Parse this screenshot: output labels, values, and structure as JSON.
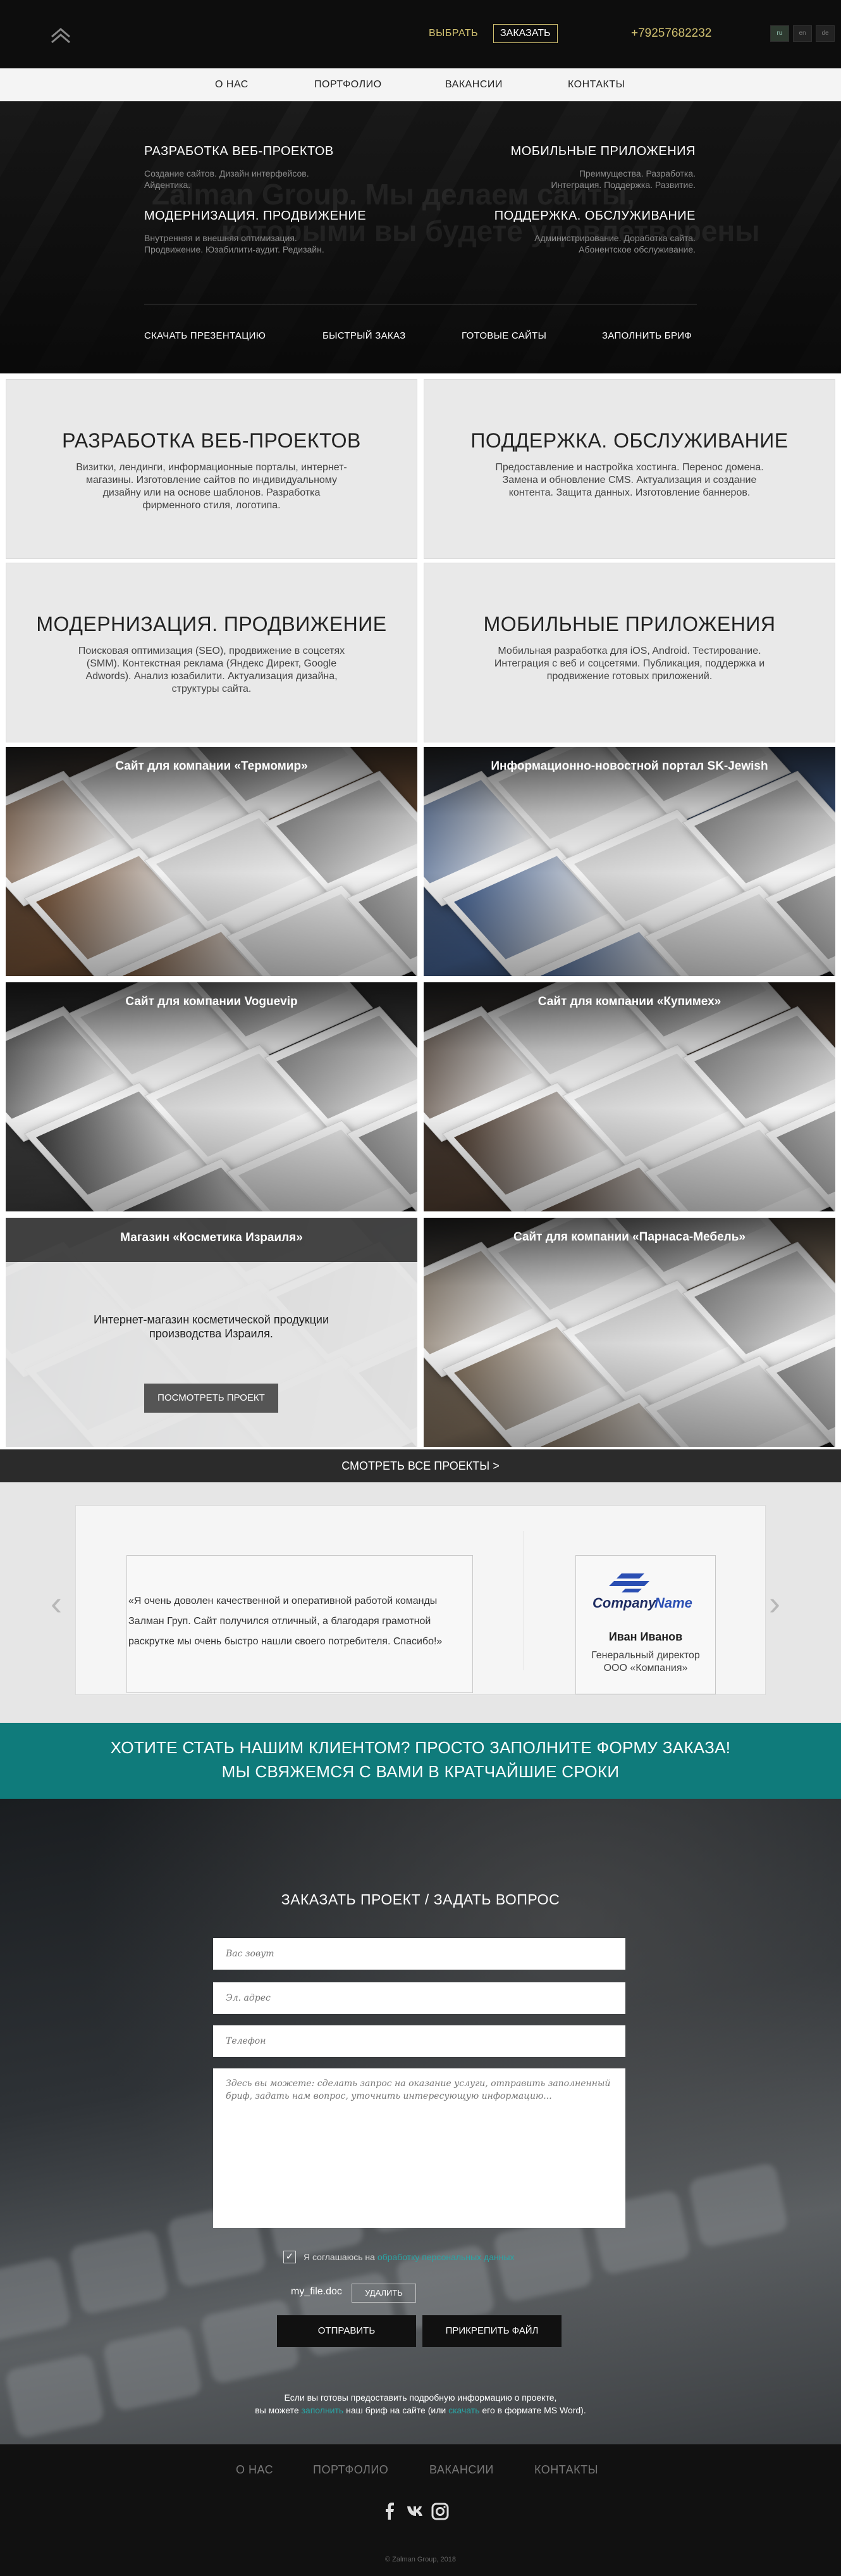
{
  "topbar": {
    "choose": "ВЫБРАТЬ",
    "order": "ЗАКАЗАТЬ",
    "phone": "+79257682232",
    "langs": [
      "ru",
      "en",
      "de"
    ]
  },
  "nav": {
    "items": [
      "О НАС",
      "ПОРТФОЛИО",
      "ВАКАНСИИ",
      "КОНТАКТЫ"
    ]
  },
  "hero": {
    "watermark_line1": "Zalman Group. Мы делаем сайты,",
    "watermark_line2": "которыми вы будете удовлетворены",
    "blocks": [
      {
        "title": "РАЗРАБОТКА ВЕБ-ПРОЕКТОВ",
        "line1": "Создание сайтов. Дизайн интерфейсов.",
        "line2": "Айдентика."
      },
      {
        "title": "МОБИЛЬНЫЕ ПРИЛОЖЕНИЯ",
        "line1": "Преимущества. Разработка.",
        "line2": "Интеграция. Поддержка. Развитие."
      },
      {
        "title": "МОДЕРНИЗАЦИЯ. ПРОДВИЖЕНИЕ",
        "line1": "Внутренняя и внешняя оптимизация.",
        "line2": "Продвижение. Юзабилити-аудит. Редизайн."
      },
      {
        "title": "ПОДДЕРЖКА. ОБСЛУЖИВАНИЕ",
        "line1": "Администрирование. Доработка сайта.",
        "line2": "Абонентское обслуживание."
      }
    ],
    "links": [
      "СКАЧАТЬ ПРЕЗЕНТАЦИЮ",
      "БЫСТРЫЙ ЗАКАЗ",
      "ГОТОВЫЕ САЙТЫ",
      "ЗАПОЛНИТЬ БРИФ"
    ]
  },
  "services": [
    {
      "title": "РАЗРАБОТКА ВЕБ-ПРОЕКТОВ",
      "text": "Визитки, лендинги, информационные порталы, интернет-магазины. Изготовление сайтов по индивидуальному дизайну или на основе шаблонов. Разработка фирменного стиля, логотипа."
    },
    {
      "title": "ПОДДЕРЖКА. ОБСЛУЖИВАНИЕ",
      "text": "Предоставление и настройка хостинга. Перенос домена. Замена и обновление CMS. Актуализация и создание контента. Защита данных. Изготовление баннеров."
    },
    {
      "title": "МОДЕРНИЗАЦИЯ. ПРОДВИЖЕНИЕ",
      "text": "Поисковая оптимизация (SEO), продвижение в соцсетях (SMM). Контекстная реклама (Яндекс Директ, Google Adwords). Анализ юзабилити. Актуализация дизайна, структуры сайта."
    },
    {
      "title": "МОБИЛЬНЫЕ ПРИЛОЖЕНИЯ",
      "text": "Мобильная разработка для iOS, Android. Тестирование. Интеграция с веб и соцсетями. Публикация, поддержка и продвижение готовых приложений."
    }
  ],
  "portfolio": {
    "items": [
      {
        "title": "Сайт для компании «Термомир»",
        "tint": "#6b4b32"
      },
      {
        "title": "Информационно-новостной портал SK-Jewish",
        "tint": "#3f5a86"
      },
      {
        "title": "Сайт для компании Voguevip",
        "tint": "#3a3a3a"
      },
      {
        "title": "Сайт для компании «Купимех»",
        "tint": "#4b3a2e"
      },
      {
        "title": "Магазин «Косметика Израиля»",
        "tint": "#9aa0a8"
      },
      {
        "title": "Сайт для компании «Парнаса-Мебель»",
        "tint": "#7a6a58"
      }
    ],
    "hover": {
      "text": "Интернет-магазин косметической продукции производства Израиля.",
      "button": "ПОСМОТРЕТЬ ПРОЕКТ"
    },
    "see_all": "СМОТРЕТЬ ВСЕ ПРОЕКТЫ >"
  },
  "testimonial": {
    "line1": "«Я очень доволен качественной и оперативной работой команды",
    "line2": "Залман Груп. Сайт получился отличный, а благодаря грамотной",
    "line3": "раскрутке мы очень быстро нашли своего потребителя. Спасибо!»",
    "logo_company": "Company",
    "logo_name": "Name",
    "name": "Иван Иванов",
    "position1": "Генеральный директор",
    "position2": "ООО «Компания»",
    "prev": "‹",
    "next": "›"
  },
  "cta": {
    "line1": "ХОТИТЕ СТАТЬ НАШИМ КЛИЕНТОМ? ПРОСТО ЗАПОЛНИТЕ ФОРМУ ЗАКАЗА!",
    "line2": "МЫ СВЯЖЕМСЯ С ВАМИ В КРАТЧАЙШИЕ СРОКИ"
  },
  "form": {
    "title": "ЗАКАЗАТЬ ПРОЕКТ / ЗАДАТЬ ВОПРОС",
    "name_placeholder": "Вас зовут",
    "email_placeholder": "Эл. адрес",
    "phone_placeholder": "Телефон",
    "message_placeholder": "Здесь вы можете: сделать запрос на оказание услуги, отправить заполненный бриф, задать нам вопрос, уточнить интересующую информацию...",
    "agree_text": "Я соглашаюсь на",
    "agree_link": "обработку персональных данных",
    "file_name": "my_file.doc",
    "delete_label": "УДАЛИТЬ",
    "send_label": "ОТПРАВИТЬ",
    "attach_label": "ПРИКРЕПИТЬ ФАЙЛ",
    "note_line1": "Если вы готовы предоставить подробную информацию о проекте,",
    "note_pre": "вы можете",
    "note_link1": "заполнить",
    "note_mid": "наш бриф на сайте (или",
    "note_link2": "скачать",
    "note_post": "его в формате MS Word)."
  },
  "footer": {
    "items": [
      "О НАС",
      "ПОРТФОЛИО",
      "ВАКАНСИИ",
      "КОНТАКТЫ"
    ],
    "copyright": "© Zalman Group, 2018"
  },
  "colors": {
    "accent_gold": "#d0c070",
    "teal": "#0f7b7b",
    "link_teal": "#2aa6a6"
  }
}
